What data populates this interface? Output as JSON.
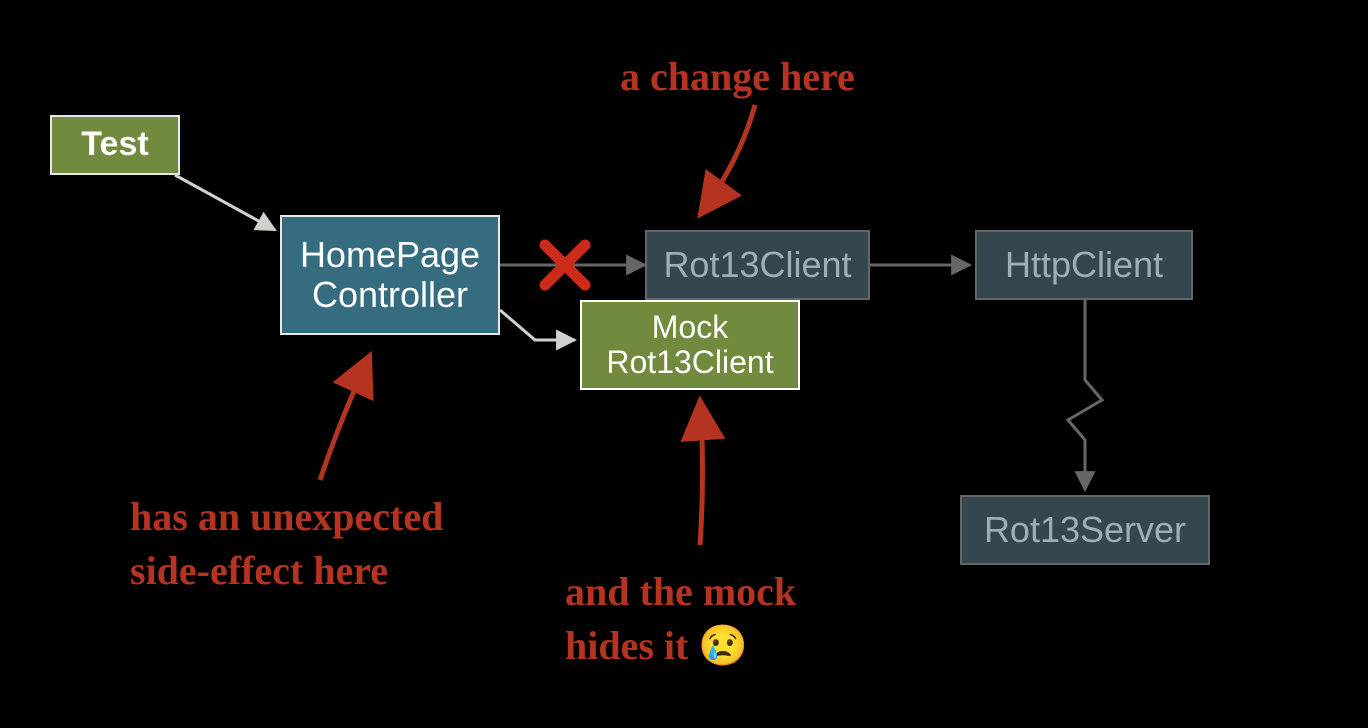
{
  "boxes": {
    "test": "Test",
    "homepage_line1": "HomePage",
    "homepage_line2": "Controller",
    "mock_line1": "Mock",
    "mock_line2": "Rot13Client",
    "rot13client": "Rot13Client",
    "httpclient": "HttpClient",
    "rot13server": "Rot13Server"
  },
  "annotations": {
    "change_here": "a change here",
    "side_effect_line1": "has an unexpected",
    "side_effect_line2": "side-effect here",
    "mock_hides_line1": "and the mock",
    "mock_hides_line2": "hides it ",
    "emoji": "😢"
  },
  "icons": {
    "cross": "cross-icon"
  }
}
